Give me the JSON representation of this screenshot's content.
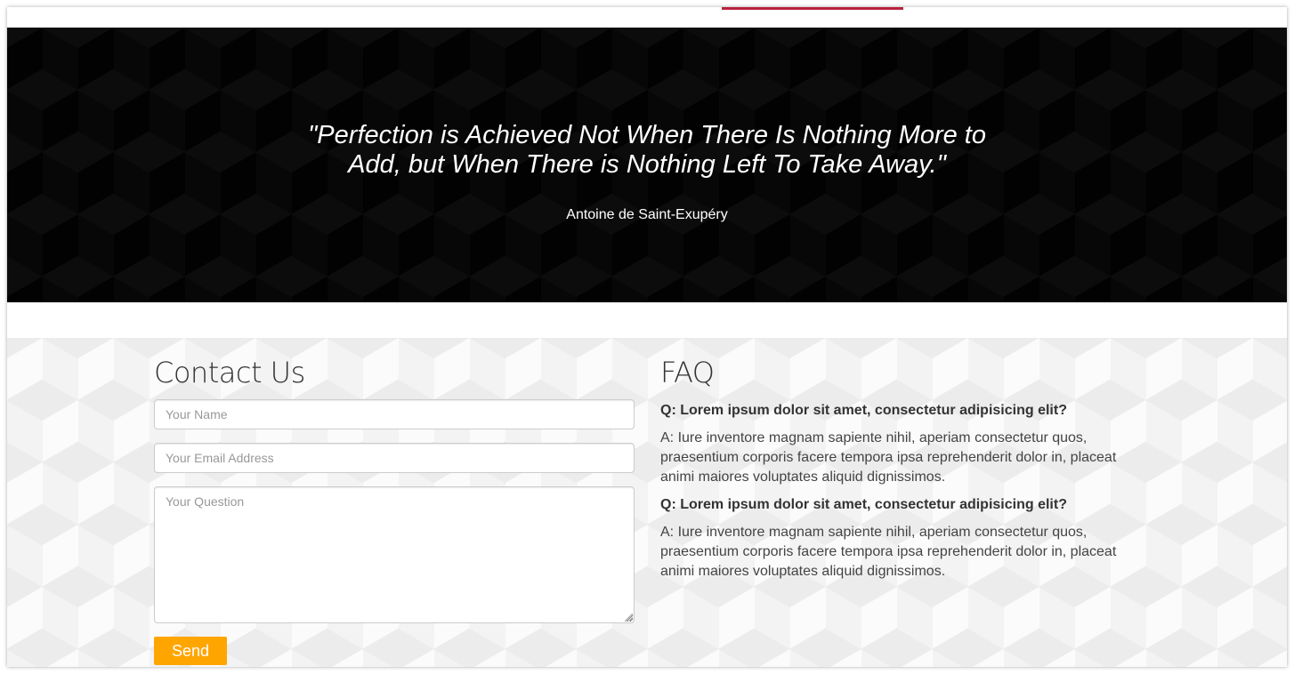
{
  "hero": {
    "quote": "\"Perfection is Achieved Not When There Is Nothing More to Add, but When There is Nothing Left To Take Away.\"",
    "author": "Antoine de Saint-Exupéry"
  },
  "contact": {
    "title": "Contact Us",
    "name_placeholder": "Your Name",
    "email_placeholder": "Your Email Address",
    "question_placeholder": "Your Question",
    "send_label": "Send",
    "accent_color": "#ffa500"
  },
  "faq": {
    "title": "FAQ",
    "items": [
      {
        "question": "Q: Lorem ipsum dolor sit amet, consectetur adipisicing elit?",
        "answer": "A: Iure inventore magnam sapiente nihil, aperiam consectetur quos, praesentium corporis facere tempora ipsa reprehenderit dolor in, placeat animi maiores voluptates aliquid dignissimos."
      },
      {
        "question": "Q: Lorem ipsum dolor sit amet, consectetur adipisicing elit?",
        "answer": "A: Iure inventore magnam sapiente nihil, aperiam consectetur quos, praesentium corporis facere tempora ipsa reprehenderit dolor in, placeat animi maiores voluptates aliquid dignissimos."
      }
    ]
  },
  "colors": {
    "nav_active_underline": "#b8223f",
    "logo_primary": "#1f3c88",
    "logo_secondary": "#74c3c7"
  }
}
